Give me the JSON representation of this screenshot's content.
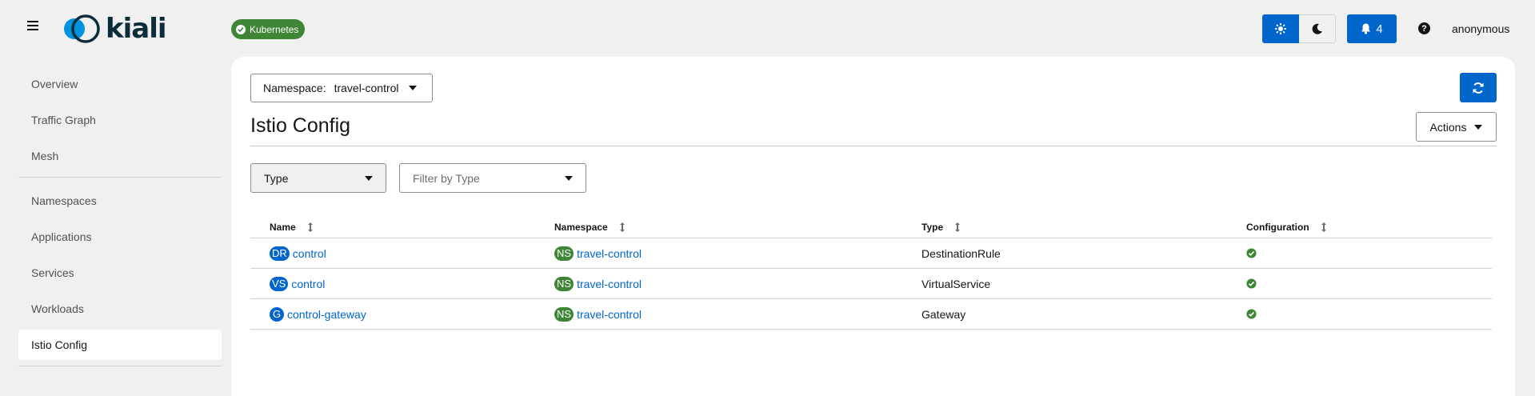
{
  "header": {
    "logo_text": "kiali",
    "cluster_badge": "Kubernetes",
    "notifications_count": "4",
    "help_label": "?",
    "user": "anonymous"
  },
  "sidebar": {
    "items": [
      {
        "label": "Overview"
      },
      {
        "label": "Traffic Graph"
      },
      {
        "label": "Mesh"
      },
      {
        "label": "Namespaces"
      },
      {
        "label": "Applications"
      },
      {
        "label": "Services"
      },
      {
        "label": "Workloads"
      },
      {
        "label": "Istio Config"
      }
    ],
    "active": "Istio Config"
  },
  "main": {
    "namespace_label": "Namespace:",
    "namespace_value": "travel-control",
    "title": "Istio Config",
    "actions_label": "Actions",
    "filter_type_label": "Type",
    "filter_placeholder": "Filter by Type",
    "table": {
      "columns": [
        "Name",
        "Namespace",
        "Type",
        "Configuration"
      ],
      "rows": [
        {
          "badge": "DR",
          "name": "control",
          "ns_badge": "NS",
          "namespace": "travel-control",
          "type": "DestinationRule",
          "config": "valid"
        },
        {
          "badge": "VS",
          "name": "control",
          "ns_badge": "NS",
          "namespace": "travel-control",
          "type": "VirtualService",
          "config": "valid"
        },
        {
          "badge": "G",
          "name": "control-gateway",
          "ns_badge": "NS",
          "namespace": "travel-control",
          "type": "Gateway",
          "config": "valid"
        }
      ]
    }
  },
  "colors": {
    "accent": "#0066cc",
    "success": "#3e8635",
    "background": "#f0f0f0"
  },
  "icons": [
    "hamburger-icon",
    "sun-icon",
    "moon-icon",
    "bell-icon",
    "help-icon",
    "sync-icon",
    "caret-down-icon",
    "sort-icon",
    "check-circle-icon"
  ]
}
